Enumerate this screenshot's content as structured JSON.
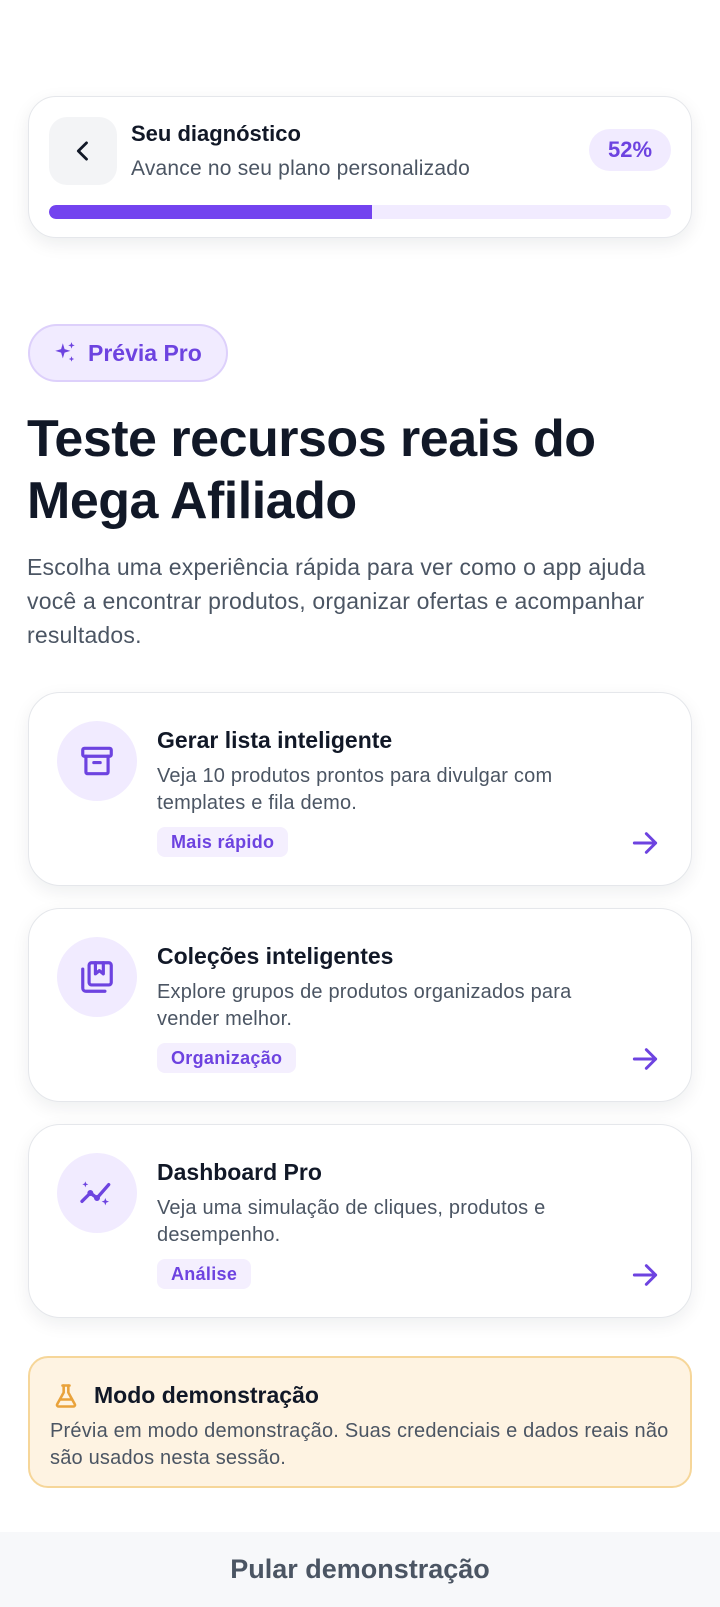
{
  "header": {
    "title": "Seu diagnóstico",
    "subtitle": "Avance no seu plano personalizado",
    "progress_label": "52%",
    "progress_value": 0.52,
    "back_icon": "chevron-left-icon"
  },
  "badge": {
    "label": "Prévia Pro",
    "icon": "sparkles-icon"
  },
  "hero": {
    "title": "Teste recursos reais do Mega Afiliado",
    "description": "Escolha uma experiência rápida para ver como o app ajuda você a encontrar produtos, organizar ofertas e acompanhar resultados."
  },
  "features": [
    {
      "title": "Gerar lista inteligente",
      "description": "Veja 10 produtos prontos para divulgar com templates e fila demo.",
      "tag": "Mais rápido",
      "icon": "archive-box-icon"
    },
    {
      "title": "Coleções inteligentes",
      "description": "Explore grupos de produtos organizados para vender melhor.",
      "tag": "Organização",
      "icon": "collection-bookmark-icon"
    },
    {
      "title": "Dashboard Pro",
      "description": "Veja uma simulação de cliques, produtos e desempenho.",
      "tag": "Análise",
      "icon": "chart-sparkle-icon"
    }
  ],
  "demo_notice": {
    "title": "Modo demonstração",
    "text": "Prévia em modo demonstração. Suas credenciais e dados reais não são usados nesta sessão.",
    "icon": "flask-icon"
  },
  "footer": {
    "skip_label": "Pular demonstração"
  },
  "colors": {
    "accent": "#7343ef",
    "accent_soft": "#f1ebff",
    "warning_bg": "#fef3e2",
    "warning_border": "#f6d699",
    "warning_icon": "#e9a23b"
  }
}
